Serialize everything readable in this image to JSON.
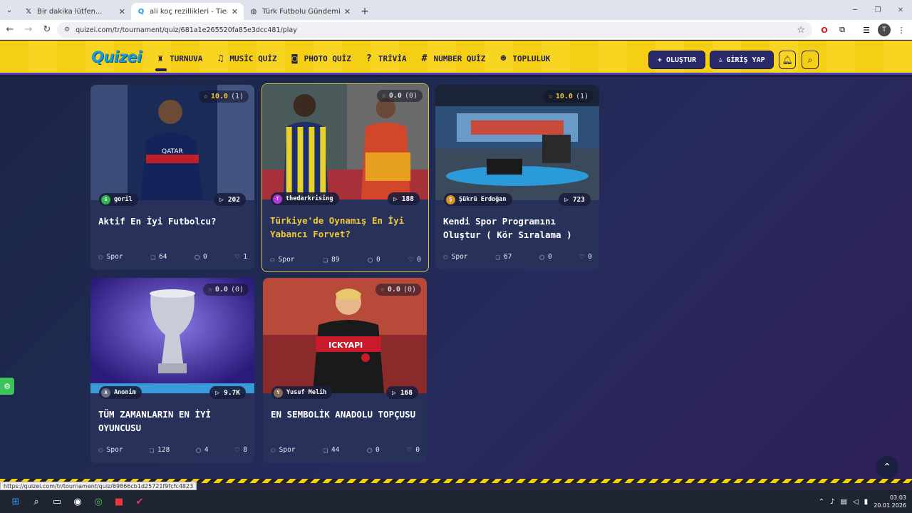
{
  "browser": {
    "tabs": [
      {
        "icon": "x-logo-icon",
        "title": "Bir dakika lütfen...",
        "active": false
      },
      {
        "icon": "quizei-favicon-icon",
        "title": "ali koç rezillikleri - Tier List, Kör",
        "active": true
      },
      {
        "icon": "globe-icon",
        "title": "Türk Futbolu Gündemi",
        "active": false
      }
    ],
    "url": "quizei.com/tr/tournament/quiz/681a1e265520fa85e3dcc481/play",
    "status_url": "https://quizei.com/tr/tournament/quiz/69866cb1d25721f9fcfc4823"
  },
  "site": {
    "logo": "Quizei",
    "nav": [
      {
        "label": "TURNUVA",
        "icon": "trophy-icon",
        "active": true
      },
      {
        "label": "MUSİC QUİZ",
        "icon": "music-note-icon",
        "active": false
      },
      {
        "label": "PHOTO QUİZ",
        "icon": "camera-icon",
        "active": false
      },
      {
        "label": "TRİVİA",
        "icon": "chat-question-icon",
        "active": false
      },
      {
        "label": "NUMBER QUİZ",
        "icon": "hash-icon",
        "active": false
      },
      {
        "label": "TOPLULUK",
        "icon": "users-icon",
        "active": false
      }
    ],
    "create_label": "+ OLUŞTUR",
    "login_label": "GİRİŞ YAP"
  },
  "cards": [
    {
      "rating": "10.0",
      "rating_count": "(1)",
      "author": "goril",
      "author_initial": "G",
      "plays": "202",
      "title": "Aktif En İyi Futbolcu?",
      "category": "Spor",
      "items": "64",
      "comments": "0",
      "likes": "1",
      "highlighted": false
    },
    {
      "rating": "0.0",
      "rating_count": "(0)",
      "author": "thedarkrising",
      "author_initial": "T",
      "plays": "188",
      "title": "Türkiye'de Oynamış En İyi Yabancı Forvet?",
      "category": "Spor",
      "items": "89",
      "comments": "0",
      "likes": "0",
      "highlighted": true
    },
    {
      "rating": "10.0",
      "rating_count": "(1)",
      "author": "Şükrü Erdoğan",
      "author_initial": "Ş",
      "plays": "723",
      "title": "Kendi Spor Programını Oluştur ( Kör Sıralama )",
      "category": "Spor",
      "items": "67",
      "comments": "0",
      "likes": "0",
      "highlighted": false
    },
    {
      "rating": "0.0",
      "rating_count": "(0)",
      "author": "Anonim",
      "author_initial": "A",
      "plays": "9.7K",
      "title": "TÜM ZAMANLARIN EN İYİ OYUNCUSU",
      "category": "Spor",
      "items": "128",
      "comments": "4",
      "likes": "8",
      "highlighted": false
    },
    {
      "rating": "0.0",
      "rating_count": "(0)",
      "author": "Yusuf Melih",
      "author_initial": "Y",
      "plays": "168",
      "title": "EN SEMBOLİK ANADOLU TOPÇUSU",
      "category": "Spor",
      "items": "44",
      "comments": "0",
      "likes": "0",
      "highlighted": false
    }
  ],
  "taskbar": {
    "time": "03:03",
    "date": "20.01.2026"
  },
  "colors": {
    "header_yellow": "#f5cf14",
    "accent_gold": "#f0c838",
    "card_bg": "#27315a",
    "brand_blue": "#1c9ad6"
  }
}
